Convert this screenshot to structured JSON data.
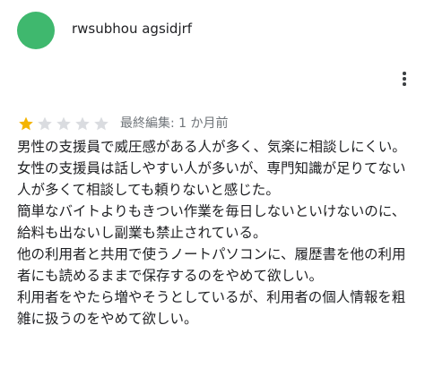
{
  "review": {
    "author_name": "rwsubhou agsidjrf",
    "avatar_color": "#3fb86e",
    "rating": 1,
    "max_rating": 5,
    "star_filled_color": "#f4b400",
    "star_empty_color": "#dadce0",
    "edited_label": "最終編集: 1 か月前",
    "more_icon": "more-vert-icon",
    "paragraphs": [
      "男性の支援員で威圧感がある人が多く、気楽に相談しにくい。",
      "女性の支援員は話しやすい人が多いが、専門知識が足りてない人が多くて相談しても頼りないと感じた。",
      "簡単なバイトよりもきつい作業を毎日しないといけないのに、給料も出ないし副業も禁止されている。",
      "他の利用者と共用で使うノートパソコンに、履歴書を他の利用者にも読めるままで保存するのをやめて欲しい。",
      "利用者をやたら増やそうとしているが、利用者の個人情報を粗雑に扱うのをやめて欲しい。"
    ]
  }
}
